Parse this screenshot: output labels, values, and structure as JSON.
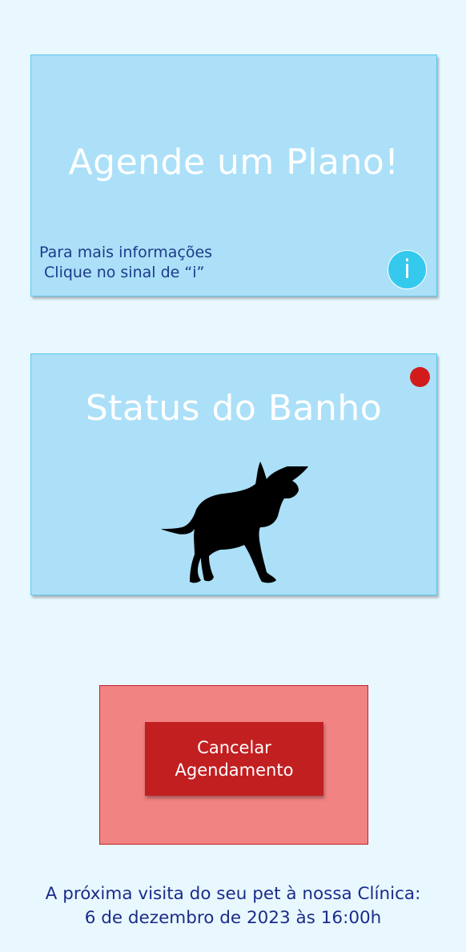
{
  "plan_card": {
    "title": "Agende um Plano!",
    "info_text_line1": "Para mais informações",
    "info_text_line2": " Clique no sinal de “i”",
    "info_button_label": "i"
  },
  "status_card": {
    "title": "Status do Banho",
    "indicator_color": "#d21c1c",
    "icon": "dog-silhouette-icon"
  },
  "cancel": {
    "label_line1": "Cancelar",
    "label_line2": "Agendamento"
  },
  "next_visit": {
    "line1": "A próxima visita do seu pet à nossa Clínica:",
    "line2": "6 de dezembro de 2023 às 16:00h"
  },
  "colors": {
    "background": "#e9f8ff",
    "card": "#abe0f8",
    "info_button": "#35c9ee",
    "cancel_panel": "#f28383",
    "cancel_button": "#c21f21",
    "text_dark_blue": "#1a2c8a"
  }
}
